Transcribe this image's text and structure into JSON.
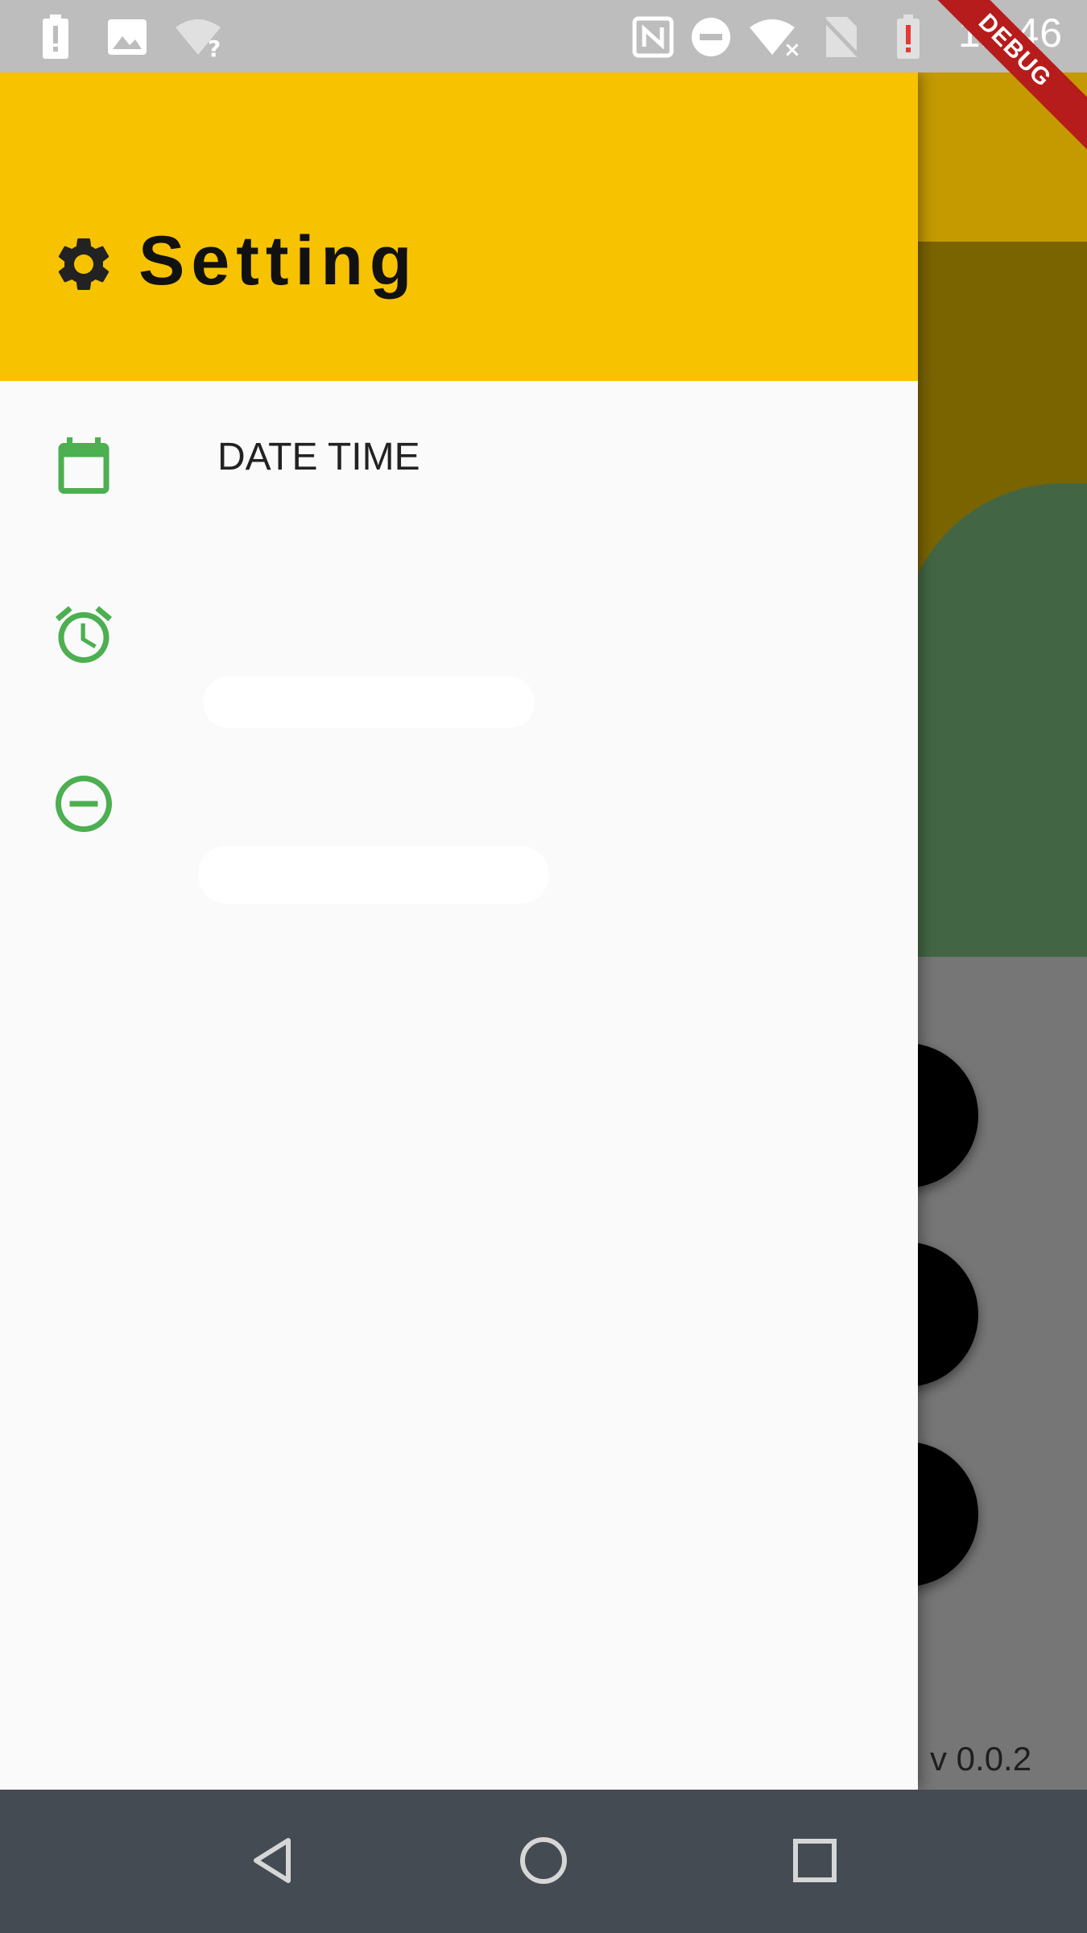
{
  "status_bar": {
    "time": "12:46",
    "icons": [
      "battery-alert-icon",
      "image-icon",
      "wifi-unknown-icon",
      "nfc-icon",
      "do-not-disturb-icon",
      "wifi-off-icon",
      "no-sim-icon",
      "battery-alert-icon"
    ]
  },
  "debug_banner": "DEBUG",
  "drawer": {
    "header": {
      "icon": "gear-icon",
      "title": "Setting"
    },
    "items": [
      {
        "icon": "calendar-icon",
        "label": "DATE TIME"
      },
      {
        "icon": "alarm-icon",
        "label": ""
      },
      {
        "icon": "minus-circle-icon",
        "label": ""
      }
    ]
  },
  "background_app": {
    "version": "v 0.0.2"
  },
  "nav_bar": {
    "buttons": [
      "back-icon",
      "home-icon",
      "recents-icon"
    ]
  },
  "colors": {
    "accent_yellow": "#f7c200",
    "icon_green": "#4caf50",
    "nav_bar": "#444b52"
  }
}
